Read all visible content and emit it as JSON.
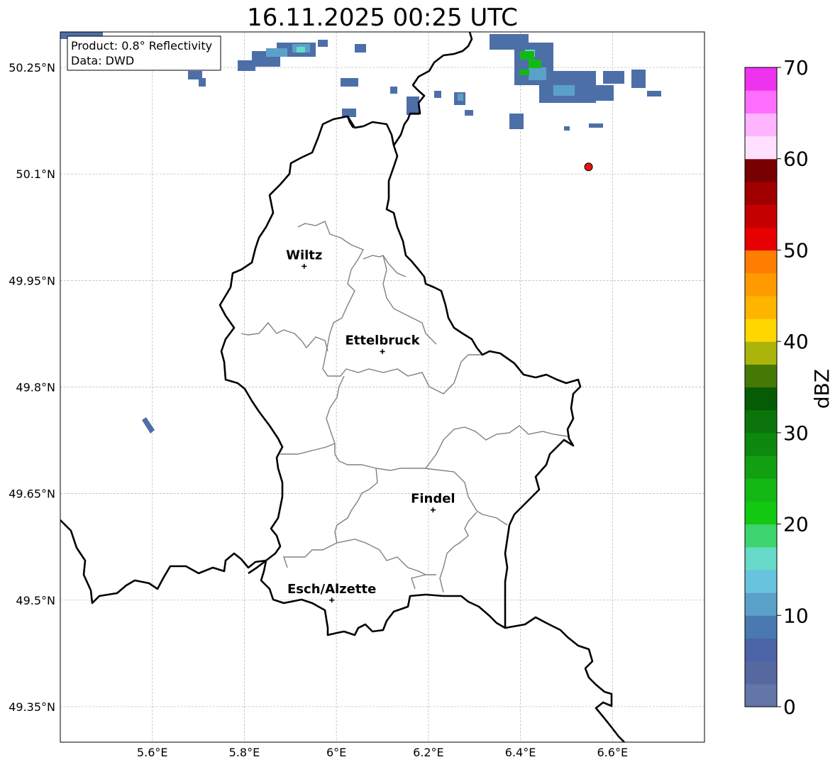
{
  "title": "16.11.2025 00:25 UTC",
  "info_box": {
    "product": "Product: 0.8° Reflectivity",
    "source": "Data: DWD"
  },
  "map": {
    "lon_range": [
      5.4,
      6.8
    ],
    "lat_range": [
      49.3,
      50.3
    ],
    "lon_ticks": [
      {
        "value": 5.6,
        "label": "5.6°E"
      },
      {
        "value": 5.8,
        "label": "5.8°E"
      },
      {
        "value": 6.0,
        "label": "6°E"
      },
      {
        "value": 6.2,
        "label": "6.2°E"
      },
      {
        "value": 6.4,
        "label": "6.4°E"
      },
      {
        "value": 6.6,
        "label": "6.6°E"
      }
    ],
    "lat_ticks": [
      {
        "value": 50.25,
        "label": "50.25°N"
      },
      {
        "value": 50.1,
        "label": "50.1°N"
      },
      {
        "value": 49.95,
        "label": "49.95°N"
      },
      {
        "value": 49.8,
        "label": "49.8°N"
      },
      {
        "value": 49.65,
        "label": "49.65°N"
      },
      {
        "value": 49.5,
        "label": "49.5°N"
      },
      {
        "value": 49.35,
        "label": "49.35°N"
      }
    ],
    "gridlines": true,
    "cities": [
      {
        "name": "Wiltz",
        "lon": 5.93,
        "lat": 49.97
      },
      {
        "name": "Ettelbruck",
        "lon": 6.1,
        "lat": 49.85
      },
      {
        "name": "Findel",
        "lon": 6.21,
        "lat": 49.627
      },
      {
        "name": "Esch/Alzette",
        "lon": 5.99,
        "lat": 49.5
      }
    ],
    "radar_site": {
      "lon": 6.548,
      "lat": 50.11,
      "color": "#ee1111"
    }
  },
  "colorbar": {
    "label": "dBZ",
    "min": 0,
    "max": 70,
    "step": 2.5,
    "ticks": [
      {
        "value": 0,
        "label": "0"
      },
      {
        "value": 10,
        "label": "10"
      },
      {
        "value": 20,
        "label": "20"
      },
      {
        "value": 30,
        "label": "30"
      },
      {
        "value": 40,
        "label": "40"
      },
      {
        "value": 50,
        "label": "50"
      },
      {
        "value": 60,
        "label": "60"
      },
      {
        "value": 70,
        "label": "70"
      }
    ],
    "colors": [
      "#6475a8",
      "#5568a0",
      "#4a64a5",
      "#4a78b0",
      "#5ba0c8",
      "#68c3de",
      "#66d9c8",
      "#3dd46e",
      "#12c812",
      "#14b814",
      "#12a012",
      "#0d8a0d",
      "#0b740b",
      "#055c05",
      "#467805",
      "#aab40a",
      "#ffd700",
      "#ffb400",
      "#ff9a00",
      "#ff7d00",
      "#e60000",
      "#c40000",
      "#a00000",
      "#780000",
      "#ffe0ff",
      "#ffb4ff",
      "#ff6eff",
      "#ee33ee"
    ]
  }
}
